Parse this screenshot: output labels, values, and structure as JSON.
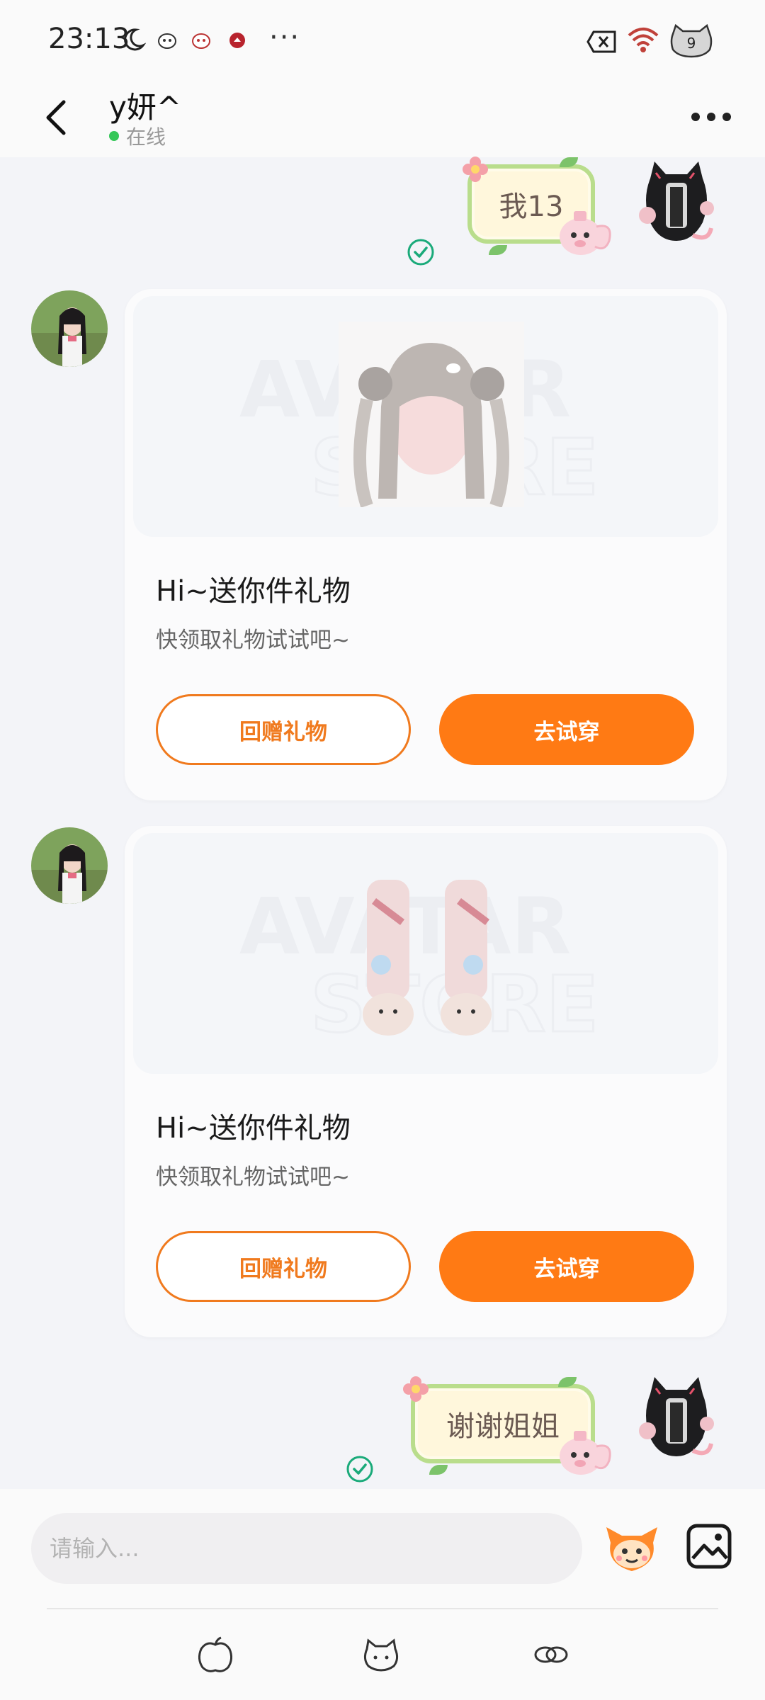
{
  "status_bar": {
    "time": "23:13",
    "more": "···",
    "battery_level": "9"
  },
  "header": {
    "name": "y妍^",
    "status": "在线"
  },
  "messages": [
    {
      "type": "sticker",
      "side": "right",
      "text": "我13"
    },
    {
      "type": "gift",
      "side": "left",
      "title": "Hi~送你件礼物",
      "subtitle": "快领取礼物试试吧~",
      "btn_return": "回赠礼物",
      "btn_try": "去试穿",
      "item": "hair"
    },
    {
      "type": "gift",
      "side": "left",
      "title": "Hi~送你件礼物",
      "subtitle": "快领取礼物试试吧~",
      "btn_return": "回赠礼物",
      "btn_try": "去试穿",
      "item": "socks"
    },
    {
      "type": "sticker",
      "side": "right",
      "text": "谢谢姐姐"
    }
  ],
  "input": {
    "placeholder": "请输入..."
  },
  "colors": {
    "accent": "#ff7a14",
    "online": "#35c758",
    "read_check": "#1aaa7a"
  }
}
